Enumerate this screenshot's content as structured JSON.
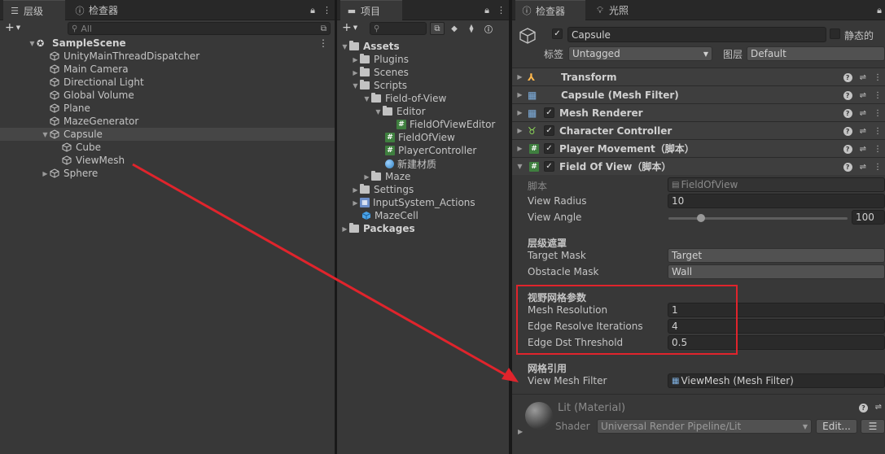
{
  "hierarchy": {
    "tabs": [
      {
        "label": "层级",
        "icon": "list-icon"
      },
      {
        "label": "检查器",
        "icon": "info-icon"
      }
    ],
    "search_placeholder": "All",
    "scene": "SampleScene",
    "items": [
      {
        "label": "UnityMainThreadDispatcher"
      },
      {
        "label": "Main Camera"
      },
      {
        "label": "Directional Light"
      },
      {
        "label": "Global Volume"
      },
      {
        "label": "Plane"
      },
      {
        "label": "MazeGenerator"
      },
      {
        "label": "Capsule"
      },
      {
        "label": "Cube"
      },
      {
        "label": "ViewMesh"
      },
      {
        "label": "Sphere"
      }
    ]
  },
  "project": {
    "tab": "项目",
    "items": [
      {
        "label": "Assets"
      },
      {
        "label": "Plugins"
      },
      {
        "label": "Scenes"
      },
      {
        "label": "Scripts"
      },
      {
        "label": "Field-of-View"
      },
      {
        "label": "Editor"
      },
      {
        "label": "FieldOfViewEditor"
      },
      {
        "label": "FieldOfView"
      },
      {
        "label": "PlayerController"
      },
      {
        "label": "新建材质"
      },
      {
        "label": "Maze"
      },
      {
        "label": "Settings"
      },
      {
        "label": "InputSystem_Actions"
      },
      {
        "label": "MazeCell"
      },
      {
        "label": "Packages"
      }
    ]
  },
  "inspector": {
    "tabs": [
      {
        "label": "检查器"
      },
      {
        "label": "光照"
      }
    ],
    "object_name": "Capsule",
    "static_label": "静态的",
    "tag_label": "标签",
    "tag_value": "Untagged",
    "layer_label": "图层",
    "layer_value": "Default",
    "components": [
      {
        "label": "Transform"
      },
      {
        "label": "Capsule (Mesh Filter)"
      },
      {
        "label": "Mesh Renderer"
      },
      {
        "label": "Character Controller"
      },
      {
        "label": "Player Movement（脚本）"
      },
      {
        "label": "Field Of View（脚本）"
      }
    ],
    "script_label": "脚本",
    "script_value": "FieldOfView",
    "view_radius_label": "View Radius",
    "view_radius_value": "10",
    "view_angle_label": "View Angle",
    "view_angle_value": "100",
    "view_angle_slider_fraction": 0.18,
    "layer_mask_header": "层级遮罩",
    "target_mask_label": "Target Mask",
    "target_mask_value": "Target",
    "obstacle_mask_label": "Obstacle Mask",
    "obstacle_mask_value": "Wall",
    "mesh_params_header": "视野网格参数",
    "mesh_resolution_label": "Mesh Resolution",
    "mesh_resolution_value": "1",
    "edge_iter_label": "Edge Resolve Iterations",
    "edge_iter_value": "4",
    "edge_dst_label": "Edge Dst Threshold",
    "edge_dst_value": "0.5",
    "mesh_ref_header": "网格引用",
    "view_mesh_filter_label": "View Mesh Filter",
    "view_mesh_filter_value": "ViewMesh (Mesh Filter)",
    "material_name": "Lit (Material)",
    "shader_label": "Shader",
    "shader_value": "Universal Render Pipeline/Lit",
    "edit_label": "Edit..."
  },
  "colors": {
    "annotation": "#e0242c",
    "selection": "#464646",
    "script_icon": "#3f7f3f"
  }
}
